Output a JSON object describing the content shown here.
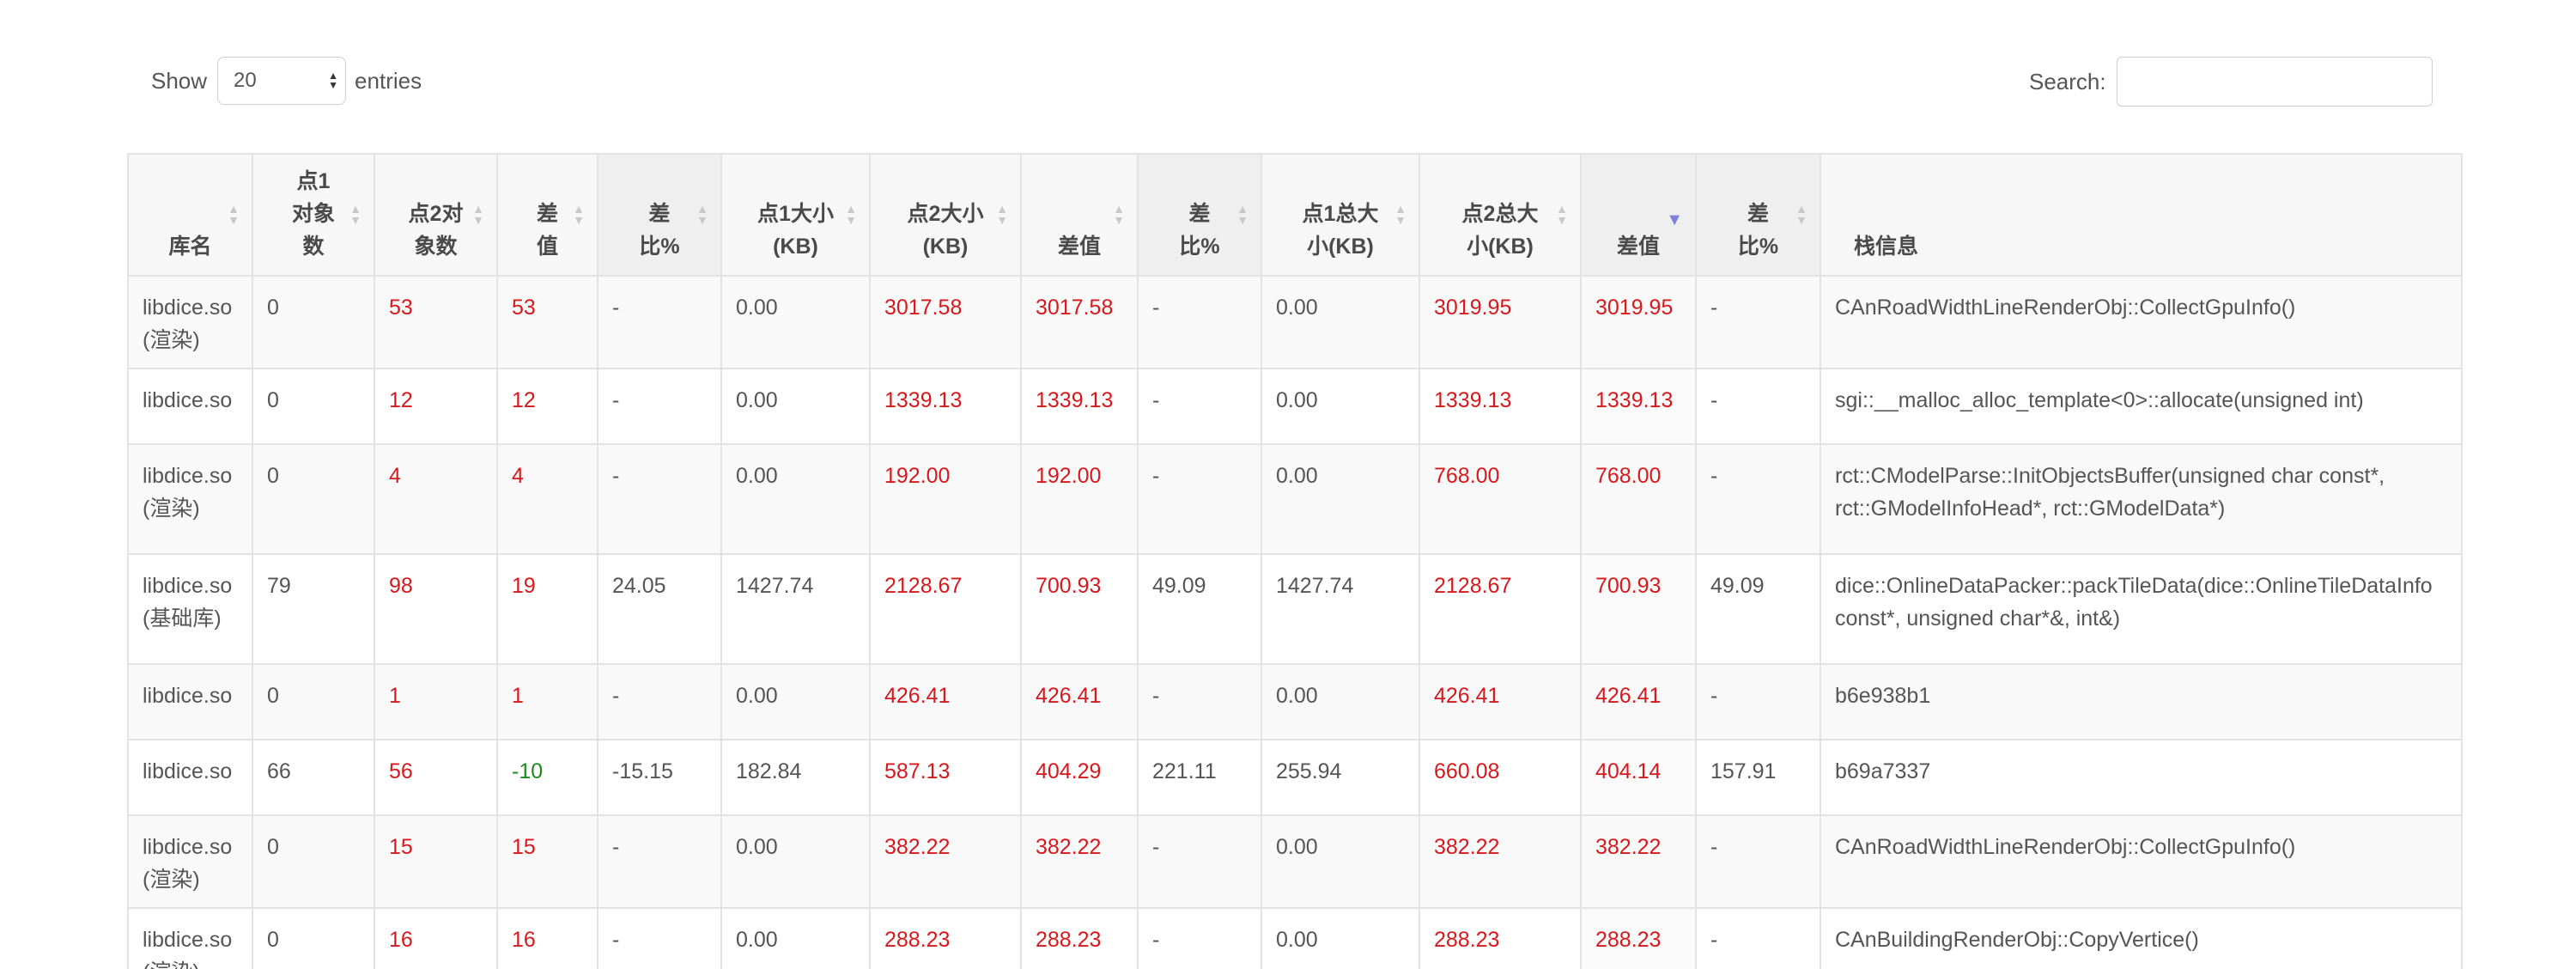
{
  "controls": {
    "show_label": "Show",
    "page_size": "20",
    "entries_label": "entries",
    "search_label": "Search:",
    "search_value": ""
  },
  "colors": {
    "increase": "#d6191c",
    "decrease": "#1e8a1e",
    "sort_active": "#7b84d8"
  },
  "icons": {
    "sort": "sort-both-icon",
    "sort_desc": "sort-desc-icon",
    "select": "select-arrows-icon"
  },
  "columns": [
    {
      "label_lines": [
        "库名"
      ]
    },
    {
      "label_lines": [
        "点1",
        "对象",
        "数"
      ]
    },
    {
      "label_lines": [
        "点2对",
        "象数"
      ]
    },
    {
      "label_lines": [
        "差",
        "值"
      ]
    },
    {
      "label_lines": [
        "差",
        "比%"
      ]
    },
    {
      "label_lines": [
        "点1大小",
        "(KB)"
      ]
    },
    {
      "label_lines": [
        "点2大小",
        "(KB)"
      ]
    },
    {
      "label_lines": [
        "差值"
      ]
    },
    {
      "label_lines": [
        "差",
        "比%"
      ]
    },
    {
      "label_lines": [
        "点1总大",
        "小(KB)"
      ]
    },
    {
      "label_lines": [
        "点2总大",
        "小(KB)"
      ]
    },
    {
      "label_lines": [
        "差值"
      ],
      "sort": "desc"
    },
    {
      "label_lines": [
        "差",
        "比%"
      ]
    },
    {
      "label_lines": [
        "栈信息"
      ]
    }
  ],
  "rows": [
    {
      "lib": [
        "libdice.so",
        "(渲染)"
      ],
      "c1": "0",
      "c2": "53",
      "d": "53",
      "dp": "-",
      "s1": "0.00",
      "s2": "3017.58",
      "sd": "3017.58",
      "sdp": "-",
      "t1": "0.00",
      "t2": "3019.95",
      "td": "3019.95",
      "tdp": "-",
      "stack": "CAnRoadWidthLineRenderObj::CollectGpuInfo()",
      "neg": false
    },
    {
      "lib": [
        "libdice.so"
      ],
      "c1": "0",
      "c2": "12",
      "d": "12",
      "dp": "-",
      "s1": "0.00",
      "s2": "1339.13",
      "sd": "1339.13",
      "sdp": "-",
      "t1": "0.00",
      "t2": "1339.13",
      "td": "1339.13",
      "tdp": "-",
      "stack": "sgi::__malloc_alloc_template<0>::allocate(unsigned int)",
      "neg": false
    },
    {
      "lib": [
        "libdice.so",
        "(渲染)"
      ],
      "c1": "0",
      "c2": "4",
      "d": "4",
      "dp": "-",
      "s1": "0.00",
      "s2": "192.00",
      "sd": "192.00",
      "sdp": "-",
      "t1": "0.00",
      "t2": "768.00",
      "td": "768.00",
      "tdp": "-",
      "stack": "rct::CModelParse::InitObjectsBuffer(unsigned char const*, rct::GModelInfoHead*, rct::GModelData*)",
      "neg": false
    },
    {
      "lib": [
        "libdice.so",
        "(基础库)"
      ],
      "c1": "79",
      "c2": "98",
      "d": "19",
      "dp": "24.05",
      "s1": "1427.74",
      "s2": "2128.67",
      "sd": "700.93",
      "sdp": "49.09",
      "t1": "1427.74",
      "t2": "2128.67",
      "td": "700.93",
      "tdp": "49.09",
      "stack": "dice::OnlineDataPacker::packTileData(dice::OnlineTileDataInfo const*, unsigned char*&, int&)",
      "neg": false
    },
    {
      "lib": [
        "libdice.so"
      ],
      "c1": "0",
      "c2": "1",
      "d": "1",
      "dp": "-",
      "s1": "0.00",
      "s2": "426.41",
      "sd": "426.41",
      "sdp": "-",
      "t1": "0.00",
      "t2": "426.41",
      "td": "426.41",
      "tdp": "-",
      "stack": "b6e938b1",
      "neg": false
    },
    {
      "lib": [
        "libdice.so"
      ],
      "c1": "66",
      "c2": "56",
      "d": "-10",
      "dp": "-15.15",
      "s1": "182.84",
      "s2": "587.13",
      "sd": "404.29",
      "sdp": "221.11",
      "t1": "255.94",
      "t2": "660.08",
      "td": "404.14",
      "tdp": "157.91",
      "stack": "b69a7337",
      "neg": true
    },
    {
      "lib": [
        "libdice.so",
        "(渲染)"
      ],
      "c1": "0",
      "c2": "15",
      "d": "15",
      "dp": "-",
      "s1": "0.00",
      "s2": "382.22",
      "sd": "382.22",
      "sdp": "-",
      "t1": "0.00",
      "t2": "382.22",
      "td": "382.22",
      "tdp": "-",
      "stack": "CAnRoadWidthLineRenderObj::CollectGpuInfo()",
      "neg": false
    },
    {
      "lib": [
        "libdice.so",
        "(渲染)"
      ],
      "c1": "0",
      "c2": "16",
      "d": "16",
      "dp": "-",
      "s1": "0.00",
      "s2": "288.23",
      "sd": "288.23",
      "sdp": "-",
      "t1": "0.00",
      "t2": "288.23",
      "td": "288.23",
      "tdp": "-",
      "stack": "CAnBuildingRenderObj::CopyVertice()",
      "neg": false
    }
  ]
}
